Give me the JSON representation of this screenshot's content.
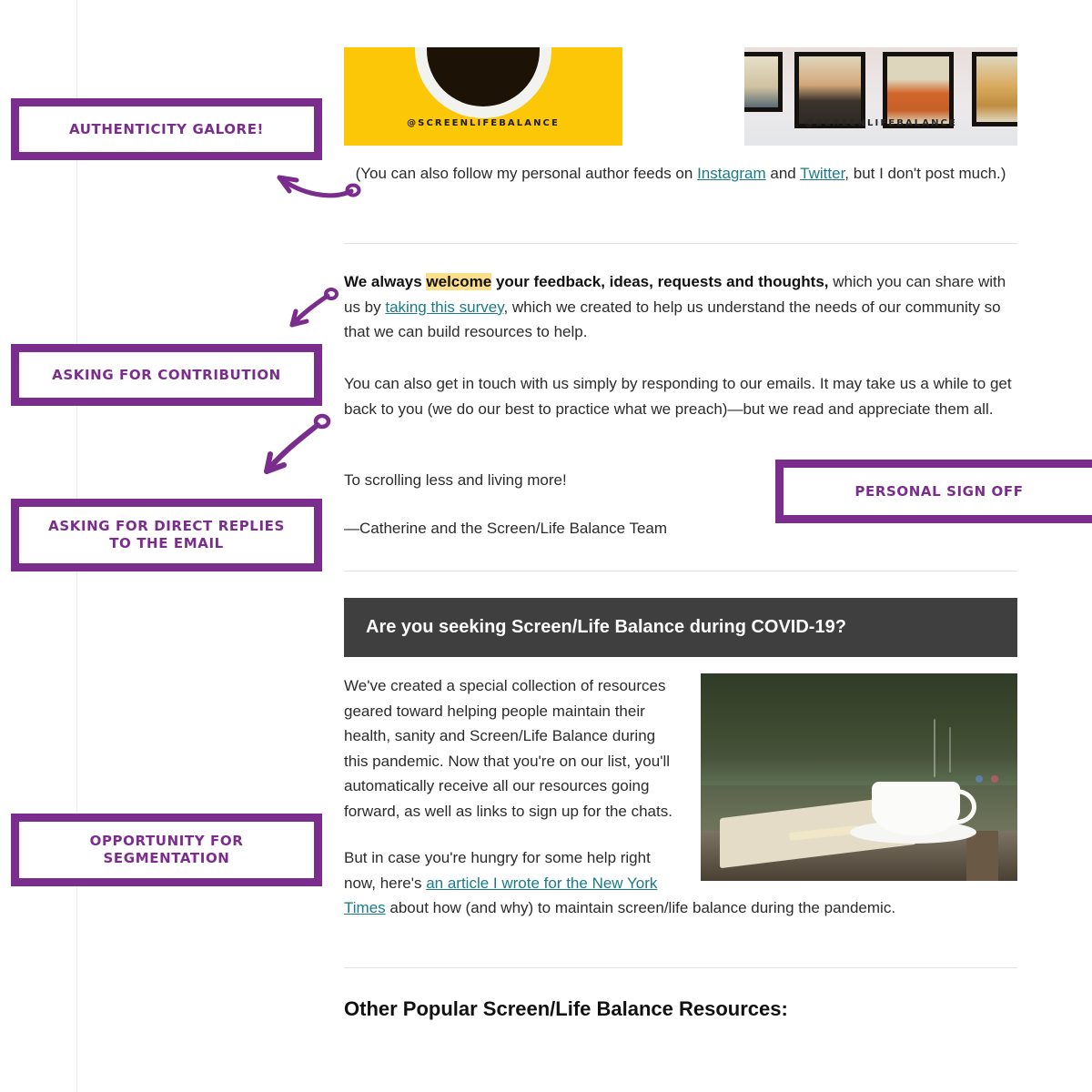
{
  "annotations": [
    {
      "id": "authenticity",
      "label": "AUTHENTICITY GALORE!"
    },
    {
      "id": "contribution",
      "label": "ASKING FOR CONTRIBUTION"
    },
    {
      "id": "direct-replies",
      "label": "ASKING FOR DIRECT REPLIES\nTO THE EMAIL"
    },
    {
      "id": "segmentation",
      "label": "OPPORTUNITY FOR\nSEGMENTATION"
    },
    {
      "id": "sign-off",
      "label": "PERSONAL SIGN OFF"
    }
  ],
  "colors": {
    "annotation_purple": "#7b2d8e",
    "link_teal": "#1a7a87",
    "highlight_yellow": "#fbdf8a",
    "dark_header": "#3f3f3f",
    "instagram_yellow": "#fbc707"
  },
  "social": {
    "left_card_handle": "@SCREENLIFEBALANCE",
    "right_card_handle": "@SCREENLIFEBALANCE"
  },
  "email": {
    "follow_note": {
      "before_link1": "(You can also follow my personal author feeds on ",
      "link1": "Instagram",
      "between": " and ",
      "link2": "Twitter",
      "after": ", but I don't post much.)"
    },
    "feedback_paragraph": {
      "bold_before_highlight": "We always ",
      "highlight": "welcome",
      "bold_after_highlight": " your feedback, ideas, requests and thoughts,",
      "plain_1": " which you can share with us by ",
      "link": "taking this survey",
      "plain_2": ", which we created to help us understand the needs of our community so that we can build resources to help."
    },
    "touch_paragraph": "You can also get in touch with us simply by responding to our emails. It may take us a while to get back to you (we do our best to practice what we preach)—but we read and appreciate them all.",
    "closing_line": "To scrolling less and living more!",
    "signature": "—Catherine and the Screen/Life Balance Team",
    "covid_header": "Are you seeking Screen/Life Balance during COVID-19?",
    "covid_paragraph_1": "We've created a special collection of resources geared toward helping people maintain their health, sanity and Screen/Life Balance during this pandemic. Now that you're on our list, you'll automatically receive all our resources going forward, as well as links to sign up for the chats.",
    "covid_paragraph_2": {
      "plain_1": "But in case you're hungry for some help right now, here's ",
      "link": "an article I wrote for the New York Times",
      "plain_2": " about how (and why) to maintain screen/life balance during the pandemic."
    },
    "resources_heading": "Other Popular Screen/Life Balance Resources:"
  }
}
